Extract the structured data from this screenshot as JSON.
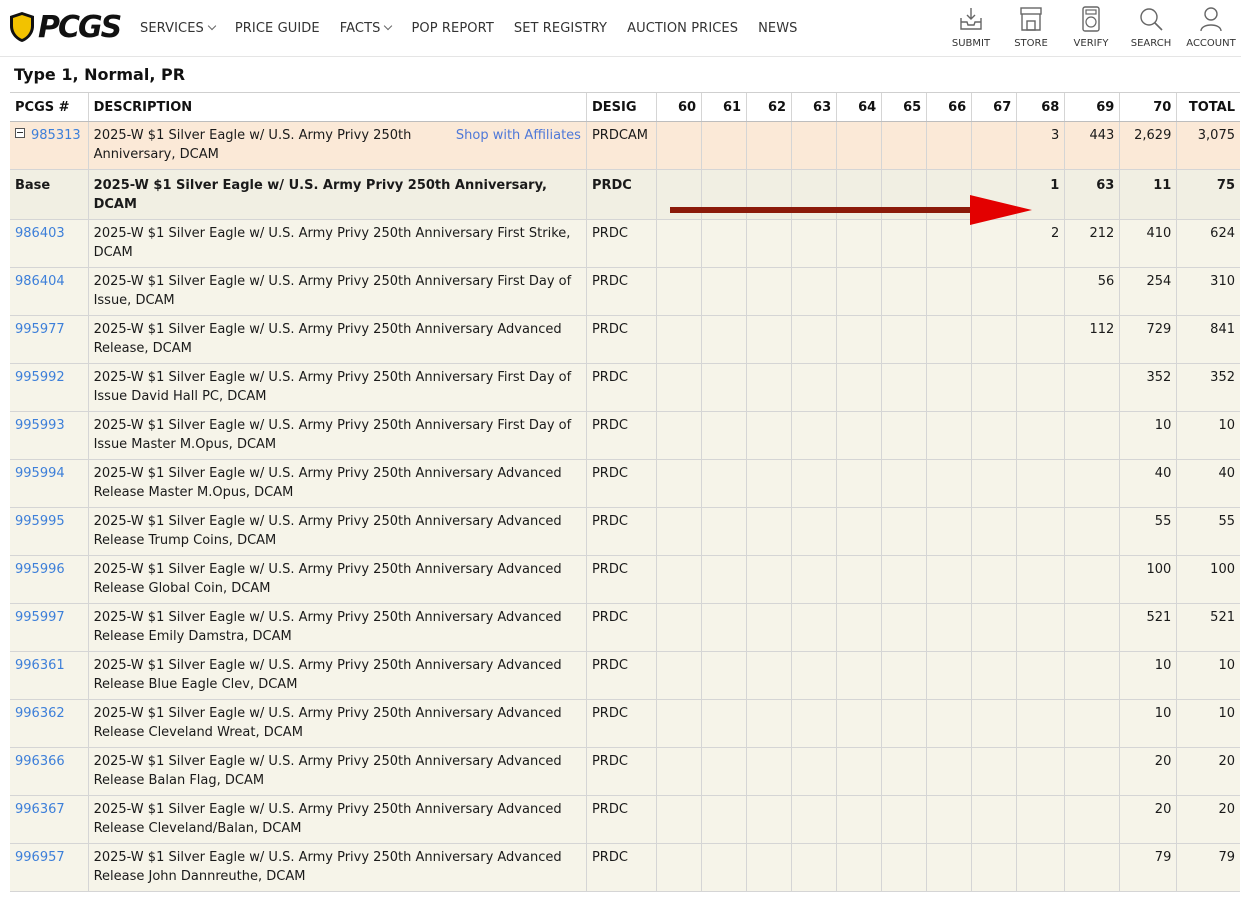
{
  "header": {
    "logo_text": "PCGS",
    "nav": [
      {
        "label": "SERVICES",
        "dropdown": true
      },
      {
        "label": "PRICE GUIDE",
        "dropdown": false
      },
      {
        "label": "FACTS",
        "dropdown": true
      },
      {
        "label": "POP REPORT",
        "dropdown": false
      },
      {
        "label": "SET REGISTRY",
        "dropdown": false
      },
      {
        "label": "AUCTION PRICES",
        "dropdown": false
      },
      {
        "label": "NEWS",
        "dropdown": false
      }
    ],
    "tools": [
      {
        "label": "SUBMIT",
        "icon": "submit-tray-icon"
      },
      {
        "label": "STORE",
        "icon": "storefront-icon"
      },
      {
        "label": "VERIFY",
        "icon": "verify-coin-holder-icon"
      },
      {
        "label": "SEARCH",
        "icon": "search-icon"
      },
      {
        "label": "ACCOUNT",
        "icon": "account-person-icon"
      }
    ]
  },
  "section_title": "Type 1, Normal, PR",
  "table": {
    "headers": [
      "PCGS #",
      "DESCRIPTION",
      "DESIG",
      "60",
      "61",
      "62",
      "63",
      "64",
      "65",
      "66",
      "67",
      "68",
      "69",
      "70",
      "TOTAL"
    ],
    "parent": {
      "pcgs": "985313",
      "description": "2025-W $1 Silver Eagle w/ U.S. Army Privy 250th Anniversary, DCAM",
      "affiliate_link": "Shop with Affiliates",
      "desig": "PRDCAM",
      "grades": [
        "",
        "",
        "",
        "",
        "",
        "",
        "",
        "",
        "3",
        "443",
        "2,629"
      ],
      "total": "3,075"
    },
    "base": {
      "label": "Base",
      "description": "2025-W $1 Silver Eagle w/ U.S. Army Privy 250th Anniversary, DCAM",
      "desig": "PRDC",
      "grades": [
        "",
        "",
        "",
        "",
        "",
        "",
        "",
        "",
        "1",
        "63",
        "11"
      ],
      "total": "75"
    },
    "rows": [
      {
        "pcgs": "986403",
        "description": "2025-W $1 Silver Eagle w/ U.S. Army Privy 250th Anniversary First Strike, DCAM",
        "desig": "PRDC",
        "grades": [
          "",
          "",
          "",
          "",
          "",
          "",
          "",
          "",
          "2",
          "212",
          "410"
        ],
        "total": "624"
      },
      {
        "pcgs": "986404",
        "description": "2025-W $1 Silver Eagle w/ U.S. Army Privy 250th Anniversary First Day of Issue, DCAM",
        "desig": "PRDC",
        "grades": [
          "",
          "",
          "",
          "",
          "",
          "",
          "",
          "",
          "",
          "56",
          "254"
        ],
        "total": "310"
      },
      {
        "pcgs": "995977",
        "description": "2025-W $1 Silver Eagle w/ U.S. Army Privy 250th Anniversary Advanced Release, DCAM",
        "desig": "PRDC",
        "grades": [
          "",
          "",
          "",
          "",
          "",
          "",
          "",
          "",
          "",
          "112",
          "729"
        ],
        "total": "841"
      },
      {
        "pcgs": "995992",
        "description": "2025-W $1 Silver Eagle w/ U.S. Army Privy 250th Anniversary First Day of Issue David Hall PC, DCAM",
        "desig": "PRDC",
        "grades": [
          "",
          "",
          "",
          "",
          "",
          "",
          "",
          "",
          "",
          "",
          "352"
        ],
        "total": "352"
      },
      {
        "pcgs": "995993",
        "description": "2025-W $1 Silver Eagle w/ U.S. Army Privy 250th Anniversary First Day of Issue Master M.Opus, DCAM",
        "desig": "PRDC",
        "grades": [
          "",
          "",
          "",
          "",
          "",
          "",
          "",
          "",
          "",
          "",
          "10"
        ],
        "total": "10"
      },
      {
        "pcgs": "995994",
        "description": "2025-W $1 Silver Eagle w/ U.S. Army Privy 250th Anniversary Advanced Release Master M.Opus, DCAM",
        "desig": "PRDC",
        "grades": [
          "",
          "",
          "",
          "",
          "",
          "",
          "",
          "",
          "",
          "",
          "40"
        ],
        "total": "40"
      },
      {
        "pcgs": "995995",
        "description": "2025-W $1 Silver Eagle w/ U.S. Army Privy 250th Anniversary Advanced Release Trump Coins, DCAM",
        "desig": "PRDC",
        "grades": [
          "",
          "",
          "",
          "",
          "",
          "",
          "",
          "",
          "",
          "",
          "55"
        ],
        "total": "55"
      },
      {
        "pcgs": "995996",
        "description": "2025-W $1 Silver Eagle w/ U.S. Army Privy 250th Anniversary Advanced Release Global Coin, DCAM",
        "desig": "PRDC",
        "grades": [
          "",
          "",
          "",
          "",
          "",
          "",
          "",
          "",
          "",
          "",
          "100"
        ],
        "total": "100"
      },
      {
        "pcgs": "995997",
        "description": "2025-W $1 Silver Eagle w/ U.S. Army Privy 250th Anniversary Advanced Release Emily Damstra, DCAM",
        "desig": "PRDC",
        "grades": [
          "",
          "",
          "",
          "",
          "",
          "",
          "",
          "",
          "",
          "",
          "521"
        ],
        "total": "521"
      },
      {
        "pcgs": "996361",
        "description": "2025-W $1 Silver Eagle w/ U.S. Army Privy 250th Anniversary Advanced Release Blue Eagle Clev, DCAM",
        "desig": "PRDC",
        "grades": [
          "",
          "",
          "",
          "",
          "",
          "",
          "",
          "",
          "",
          "",
          "10"
        ],
        "total": "10"
      },
      {
        "pcgs": "996362",
        "description": "2025-W $1 Silver Eagle w/ U.S. Army Privy 250th Anniversary Advanced Release Cleveland Wreat, DCAM",
        "desig": "PRDC",
        "grades": [
          "",
          "",
          "",
          "",
          "",
          "",
          "",
          "",
          "",
          "",
          "10"
        ],
        "total": "10"
      },
      {
        "pcgs": "996366",
        "description": "2025-W $1 Silver Eagle w/ U.S. Army Privy 250th Anniversary Advanced Release Balan Flag, DCAM",
        "desig": "PRDC",
        "grades": [
          "",
          "",
          "",
          "",
          "",
          "",
          "",
          "",
          "",
          "",
          "20"
        ],
        "total": "20"
      },
      {
        "pcgs": "996367",
        "description": "2025-W $1 Silver Eagle w/ U.S. Army Privy 250th Anniversary Advanced Release Cleveland/Balan, DCAM",
        "desig": "PRDC",
        "grades": [
          "",
          "",
          "",
          "",
          "",
          "",
          "",
          "",
          "",
          "",
          "20"
        ],
        "total": "20"
      },
      {
        "pcgs": "996957",
        "description": "2025-W $1 Silver Eagle w/ U.S. Army Privy 250th Anniversary Advanced Release John Dannreuthe, DCAM",
        "desig": "PRDC",
        "grades": [
          "",
          "",
          "",
          "",
          "",
          "",
          "",
          "",
          "",
          "",
          "79"
        ],
        "total": "79"
      }
    ]
  },
  "colors": {
    "link": "#3d7fd9",
    "parent_row": "#fbe9d7",
    "row_bg": "#f6f4e9",
    "arrow": "#8b1a0a",
    "arrow_head": "#e30000",
    "logo_shield": "#f2c200"
  }
}
